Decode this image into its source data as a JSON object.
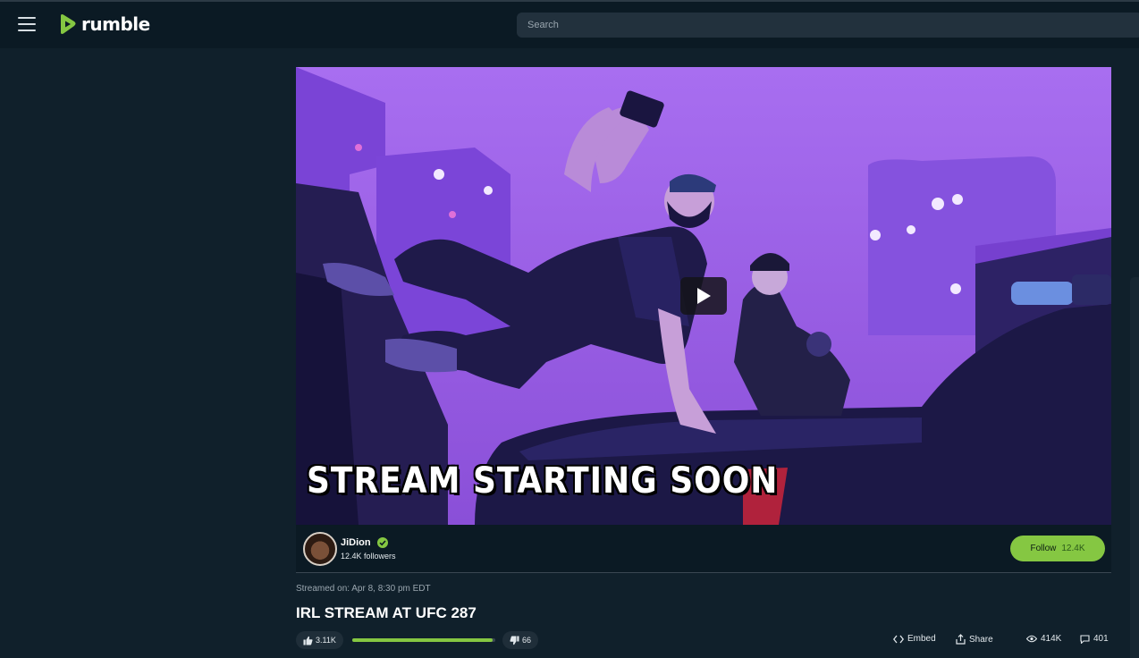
{
  "header": {
    "logo_text": "rumble",
    "search_placeholder": "Search",
    "brand_color": "#85c742"
  },
  "player": {
    "overlay_text": "STREAM STARTING SOON",
    "play_icon": "play-icon"
  },
  "channel": {
    "name": "JiDion",
    "verified_icon": "verified-check-icon",
    "followers": "12.4K followers",
    "follow_label": "Follow",
    "follow_count": "12.4K"
  },
  "video": {
    "streamed_on": "Streamed on: Apr 8, 8:30 pm EDT",
    "title": "IRL STREAM AT UFC 287"
  },
  "actions": {
    "likes": "3.11K",
    "dislikes": "66",
    "like_ratio": 0.98,
    "embed_label": "Embed",
    "share_label": "Share",
    "views": "414K",
    "comments": "401"
  }
}
